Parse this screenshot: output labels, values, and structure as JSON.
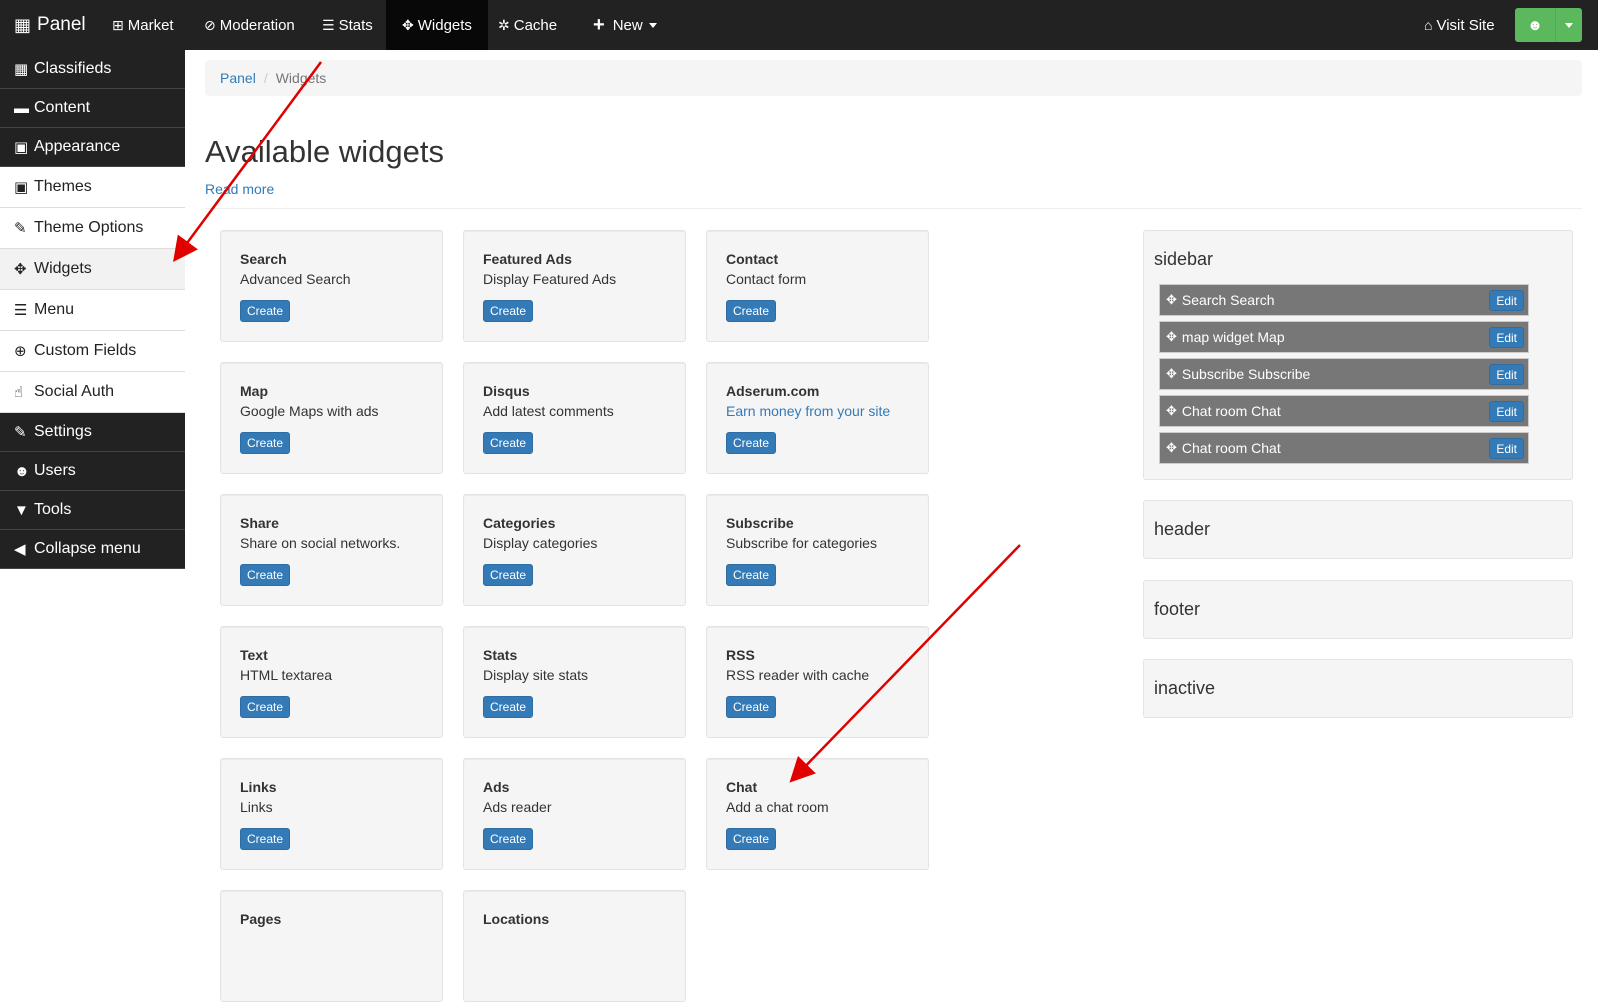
{
  "topbar": {
    "brand": "Panel",
    "items": [
      {
        "label": "Market",
        "icon": "⊞"
      },
      {
        "label": "Moderation",
        "icon": "⊘"
      },
      {
        "label": "Stats",
        "icon": "☰"
      },
      {
        "label": "Widgets",
        "icon": "✥"
      },
      {
        "label": "Cache",
        "icon": "✲"
      },
      {
        "label": "New",
        "icon": "+"
      }
    ],
    "visit_site": "Visit Site"
  },
  "sidebar": {
    "items": [
      {
        "label": "Classifieds",
        "icon": "▦"
      },
      {
        "label": "Content",
        "icon": "▬"
      },
      {
        "label": "Appearance",
        "icon": "▣"
      },
      {
        "label": "Themes",
        "icon": "▣"
      },
      {
        "label": "Theme Options",
        "icon": "✎"
      },
      {
        "label": "Widgets",
        "icon": "✥"
      },
      {
        "label": "Menu",
        "icon": "☰"
      },
      {
        "label": "Custom Fields",
        "icon": "⊕"
      },
      {
        "label": "Social Auth",
        "icon": "☝"
      },
      {
        "label": "Settings",
        "icon": "✎"
      },
      {
        "label": "Users",
        "icon": "☻"
      },
      {
        "label": "Tools",
        "icon": "▼"
      },
      {
        "label": "Collapse menu",
        "icon": "◀"
      }
    ]
  },
  "breadcrumb": {
    "root": "Panel",
    "current": "Widgets"
  },
  "page": {
    "title": "Available widgets",
    "read_more": "Read more"
  },
  "widgets": [
    {
      "title": "Search",
      "desc": "Advanced Search",
      "button": "Create"
    },
    {
      "title": "Featured Ads",
      "desc": "Display Featured Ads",
      "button": "Create"
    },
    {
      "title": "Contact",
      "desc": "Contact form",
      "button": "Create"
    },
    {
      "title": "Map",
      "desc": "Google Maps with ads",
      "button": "Create"
    },
    {
      "title": "Disqus",
      "desc": "Add latest comments",
      "button": "Create"
    },
    {
      "title": "Adserum.com",
      "desc": "Earn money from your site",
      "button": "Create"
    },
    {
      "title": "Share",
      "desc": "Share on social networks.",
      "button": "Create"
    },
    {
      "title": "Categories",
      "desc": "Display categories",
      "button": "Create"
    },
    {
      "title": "Subscribe",
      "desc": "Subscribe for categories",
      "button": "Create"
    },
    {
      "title": "Text",
      "desc": "HTML textarea",
      "button": "Create"
    },
    {
      "title": "Stats",
      "desc": "Display site stats",
      "button": "Create"
    },
    {
      "title": "RSS",
      "desc": "RSS reader with cache",
      "button": "Create"
    },
    {
      "title": "Links",
      "desc": "Links",
      "button": "Create"
    },
    {
      "title": "Ads",
      "desc": "Ads reader",
      "button": "Create"
    },
    {
      "title": "Chat",
      "desc": "Add a chat room",
      "button": "Create"
    },
    {
      "title": "Pages",
      "desc": "",
      "button": ""
    },
    {
      "title": "Locations",
      "desc": "",
      "button": ""
    }
  ],
  "zones": {
    "sidebar": {
      "title": "sidebar",
      "items": [
        {
          "label": "Search Search",
          "edit": "Edit"
        },
        {
          "label": "map widget Map",
          "edit": "Edit"
        },
        {
          "label": "Subscribe Subscribe",
          "edit": "Edit"
        },
        {
          "label": "Chat room Chat",
          "edit": "Edit"
        },
        {
          "label": "Chat room Chat",
          "edit": "Edit"
        }
      ]
    },
    "header": {
      "title": "header"
    },
    "footer": {
      "title": "footer"
    },
    "inactive": {
      "title": "inactive"
    }
  },
  "colors": {
    "annotation_arrow": "#e00000",
    "primary": "#337ab7",
    "success": "#5cb85c",
    "navbar": "#222222"
  }
}
